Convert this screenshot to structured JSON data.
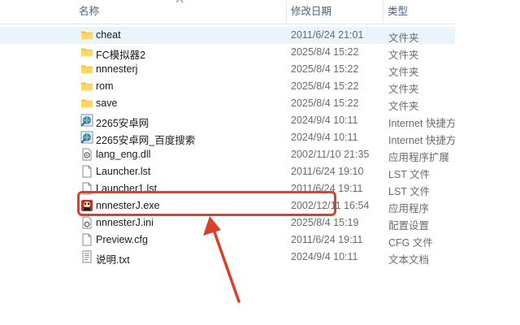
{
  "columns": {
    "name": "名称",
    "date": "修改日期",
    "type": "类型"
  },
  "files": [
    {
      "name": "cheat",
      "date": "2011/6/24 21:01",
      "type": "文件夹",
      "icon": "folder-icon",
      "selected": true
    },
    {
      "name": "FC模拟器2",
      "date": "2025/8/4 15:22",
      "type": "文件夹",
      "icon": "folder-icon"
    },
    {
      "name": "nnnesterj",
      "date": "2025/8/4 15:22",
      "type": "文件夹",
      "icon": "folder-icon"
    },
    {
      "name": "rom",
      "date": "2025/8/4 15:22",
      "type": "文件夹",
      "icon": "folder-icon"
    },
    {
      "name": "save",
      "date": "2025/8/4 15:22",
      "type": "文件夹",
      "icon": "folder-icon"
    },
    {
      "name": "2265安卓网",
      "date": "2024/9/4 10:11",
      "type": "Internet 快捷方式",
      "icon": "internet-shortcut-icon"
    },
    {
      "name": "2265安卓网_百度搜索",
      "date": "2024/9/4 10:11",
      "type": "Internet 快捷方式",
      "icon": "internet-shortcut-icon"
    },
    {
      "name": "lang_eng.dll",
      "date": "2002/11/10 21:35",
      "type": "应用程序扩展",
      "icon": "dll-file-icon"
    },
    {
      "name": "Launcher.lst",
      "date": "2011/6/24 19:10",
      "type": "LST 文件",
      "icon": "file-icon"
    },
    {
      "name": "Launcher1.lst",
      "date": "2011/6/24 19:11",
      "type": "LST 文件",
      "icon": "file-icon"
    },
    {
      "name": "nnnesterJ.exe",
      "date": "2002/12/11 16:54",
      "type": "应用程序",
      "icon": "exe-app-icon"
    },
    {
      "name": "nnnesterJ.ini",
      "date": "2025/8/4 15:19",
      "type": "配置设置",
      "icon": "settings-file-icon"
    },
    {
      "name": "Preview.cfg",
      "date": "2011/6/24 19:11",
      "type": "CFG 文件",
      "icon": "file-icon"
    },
    {
      "name": "说明.txt",
      "date": "2024/9/4 10:11",
      "type": "文本文档",
      "icon": "text-file-icon"
    }
  ],
  "colors": {
    "annotation": "#d9412b",
    "folder": "#f5c04a",
    "selection": "#eaf4fd",
    "header_text": "#4c607a"
  }
}
